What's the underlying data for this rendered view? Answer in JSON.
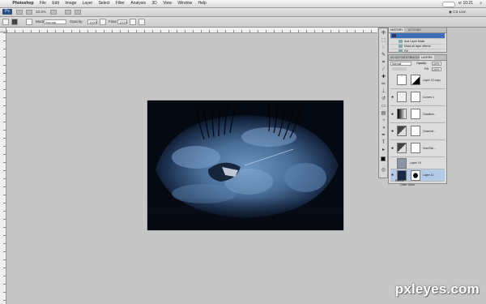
{
  "menubar": {
    "app": "Photoshop",
    "items": [
      "File",
      "Edit",
      "Image",
      "Layer",
      "Select",
      "Filter",
      "Analysis",
      "3D",
      "View",
      "Window",
      "Help"
    ],
    "workspaces": [
      "ESSENTIALS",
      "DESIGN",
      "PAINTING"
    ],
    "clock": "vr 10:21",
    "cs_live": "CS Live"
  },
  "optbar": {
    "mode_label": "Mode:",
    "mode_value": "Normal",
    "opacity_label": "Opacity:",
    "opacity_value": "100%",
    "flow_label": "Flow:",
    "flow_value": "100%"
  },
  "zoom": "33.3%",
  "history": {
    "tabs": [
      "HISTORY",
      "ACTIONS"
    ],
    "items": [
      {
        "label": "Add Layer Mask",
        "selected": false
      },
      {
        "label": "Mask all layer effects",
        "selected": false
      },
      {
        "label": "Fill",
        "selected": false
      }
    ]
  },
  "layers": {
    "tabs": [
      "ADJUSTMENTS",
      "MASKS",
      "LAYERS"
    ],
    "blend": "Normal",
    "opacity_label": "Opacity:",
    "opacity": "100%",
    "fill_label": "Fill:",
    "fill": "100%",
    "rows": [
      {
        "name": "Layer 13 copy"
      },
      {
        "name": "Curves 1"
      },
      {
        "name": "Gradient..."
      },
      {
        "name": "Channel..."
      },
      {
        "name": "Hue/Sat..."
      },
      {
        "name": "Layer 19"
      },
      {
        "name": "Layer 11"
      }
    ],
    "effects": [
      "Effects",
      "Outer Glow"
    ]
  },
  "watermark": "pxleyes.com",
  "colors": {
    "accent": "#3f6fb8",
    "canvas_dark": "#050912",
    "eye_blue": "#4a6f99"
  }
}
